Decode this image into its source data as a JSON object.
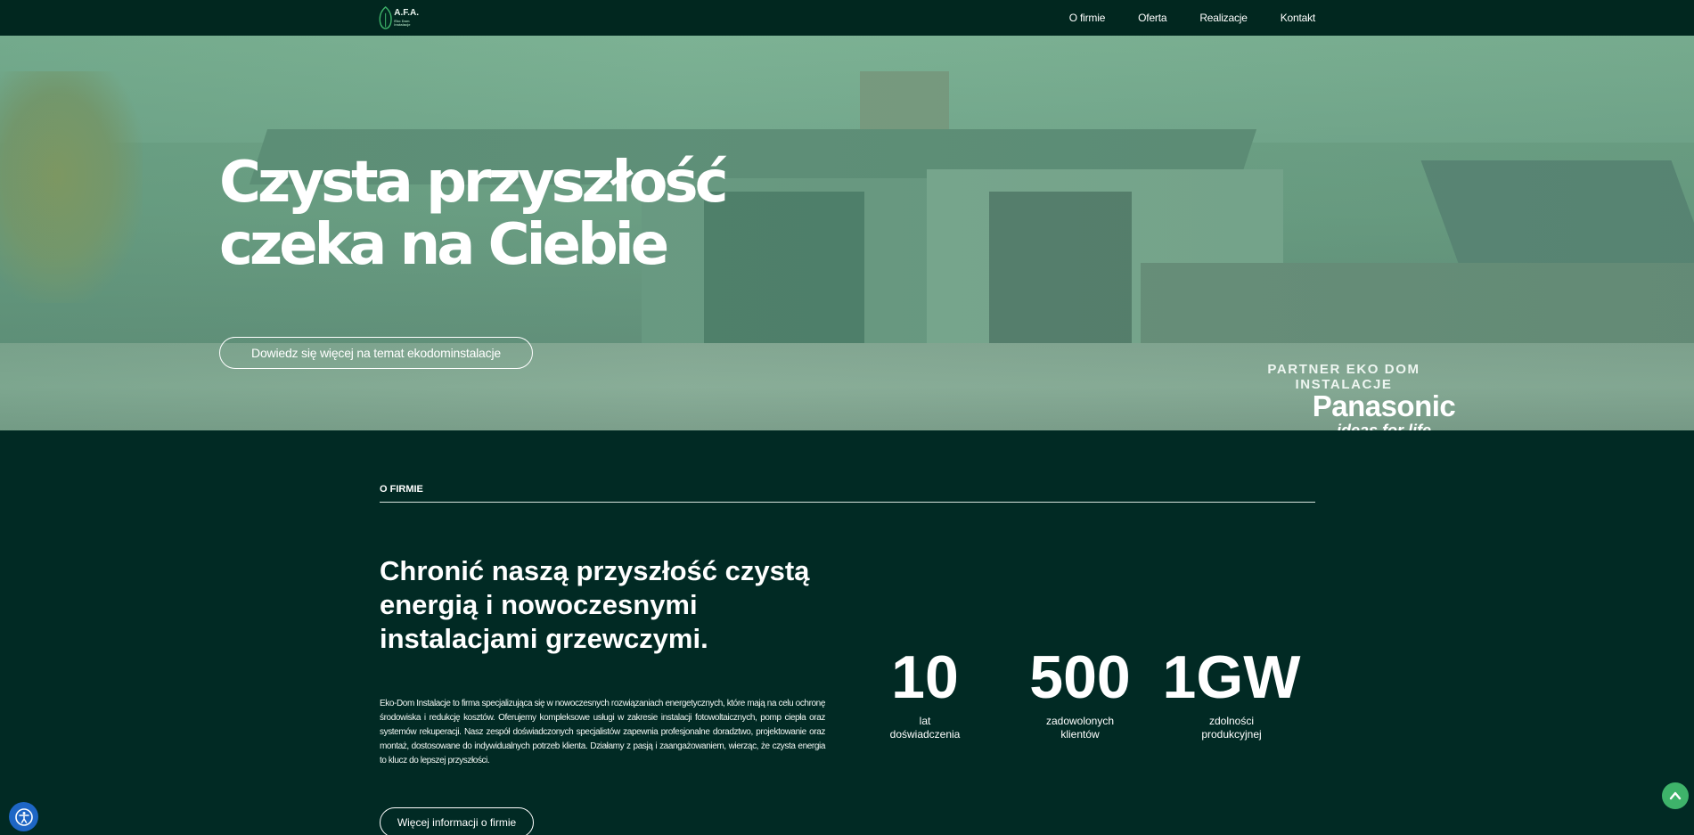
{
  "nav": {
    "logo_text": "A.F.A.",
    "logo_sub": "Eko Dom Instalacje",
    "items": [
      {
        "label": "O firmie"
      },
      {
        "label": "Oferta"
      },
      {
        "label": "Realizacje"
      },
      {
        "label": "Kontakt"
      }
    ]
  },
  "hero": {
    "title_line1": "Czysta przyszłość",
    "title_line2": "czeka na Ciebie",
    "button_label": "Dowiedz się więcej na temat ekodominstalacje",
    "partner_label": "PARTNER EKO DOM INSTALACJE",
    "partner_brand": "Panasonic",
    "partner_tagline": "ideas for life"
  },
  "about": {
    "section_label": "O FIRMIE",
    "heading": "Chronić naszą przyszłość czystą energią i nowoczesnymi instalacjami grzewczymi.",
    "body": "Eko-Dom Instalacje to firma specjalizująca się w nowoczesnych rozwiązaniach energetycznych, które mają na celu ochronę środowiska i redukcję kosztów. Oferujemy kompleksowe usługi w zakresie instalacji fotowoltaicznych, pomp ciepła oraz systemów rekuperacji. Nasz zespół doświadczonych specjalistów zapewnia profesjonalne doradztwo, projektowanie oraz montaż, dostosowane do indywidualnych potrzeb klienta. Działamy z pasją i zaangażowaniem, wierząc, że czysta energia to klucz do lepszej przyszłości.",
    "button_label": "Więcej informacji o firmie",
    "stats": [
      {
        "value": "10",
        "label_line1": "lat",
        "label_line2": "doświadczenia"
      },
      {
        "value": "500",
        "label_line1": "zadowolonych",
        "label_line2": "klientów"
      },
      {
        "value": "1GW",
        "label_line1": "zdolności",
        "label_line2": "produkcyjnej"
      }
    ]
  },
  "widgets": {
    "accessibility_icon": "accessibility-icon",
    "scroll_top_icon": "chevron-up-icon"
  },
  "colors": {
    "background": "#012a24",
    "nav": "#01271f",
    "accent_green": "#3eb36a",
    "accessibility_blue": "#1e66c5"
  }
}
